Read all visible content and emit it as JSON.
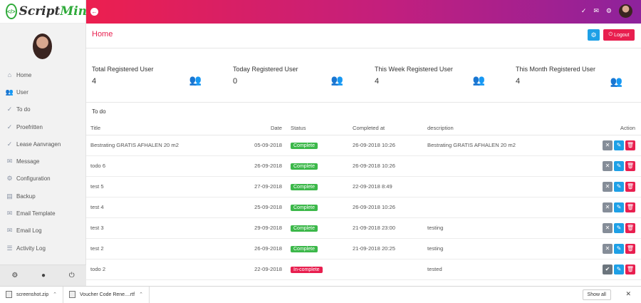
{
  "brand": {
    "part1": "Script",
    "part2": "Mint"
  },
  "header": {
    "title": "Home",
    "logout_label": "Logout"
  },
  "sidebar": {
    "items": [
      {
        "label": "Home",
        "icon": "home-icon"
      },
      {
        "label": "User",
        "icon": "users-icon"
      },
      {
        "label": "To do",
        "icon": "check-circle-icon"
      },
      {
        "label": "Proefritten",
        "icon": "check-circle-icon"
      },
      {
        "label": "Lease Aanvragen",
        "icon": "check-circle-icon"
      },
      {
        "label": "Message",
        "icon": "envelope-open-icon"
      },
      {
        "label": "Configuration",
        "icon": "gears-icon"
      },
      {
        "label": "Backup",
        "icon": "database-icon"
      },
      {
        "label": "Email Template",
        "icon": "envelope-icon"
      },
      {
        "label": "Email Log",
        "icon": "envelope-icon"
      },
      {
        "label": "Activity Log",
        "icon": "list-icon"
      }
    ]
  },
  "stats": [
    {
      "label": "Total Registered User",
      "value": "4"
    },
    {
      "label": "Today Registered User",
      "value": "0"
    },
    {
      "label": "This Week Registered User",
      "value": "4"
    },
    {
      "label": "This Month Registered User",
      "value": "4"
    }
  ],
  "todo": {
    "heading": "To do",
    "columns": {
      "title": "Title",
      "date": "Date",
      "status": "Status",
      "completed": "Completed at",
      "description": "description",
      "action": "Action"
    },
    "rows": [
      {
        "title": "Bestrating GRATIS AFHALEN 20 m2",
        "date": "05-09-2018",
        "status": "Complete",
        "completed": "26-09-2018 10:26",
        "description": "Bestrating GRATIS AFHALEN 20 m2"
      },
      {
        "title": "todo 6",
        "date": "26-09-2018",
        "status": "Complete",
        "completed": "26-09-2018 10:26",
        "description": ""
      },
      {
        "title": "test 5",
        "date": "27-09-2018",
        "status": "Complete",
        "completed": "22-09-2018 8:49",
        "description": ""
      },
      {
        "title": "test 4",
        "date": "25-09-2018",
        "status": "Complete",
        "completed": "26-09-2018 10:26",
        "description": ""
      },
      {
        "title": "test 3",
        "date": "29-09-2018",
        "status": "Complete",
        "completed": "21-09-2018 23:00",
        "description": "testing"
      },
      {
        "title": "test 2",
        "date": "26-09-2018",
        "status": "Complete",
        "completed": "21-09-2018 20:25",
        "description": "testing"
      },
      {
        "title": "todo 2",
        "date": "22-09-2018",
        "status": "In-complete",
        "completed": "",
        "description": "tested"
      }
    ]
  },
  "downloads": {
    "items": [
      {
        "name": "screenshot.zip"
      },
      {
        "name": "Voucher Code Rene....rtf"
      }
    ],
    "show_all": "Show all"
  },
  "colors": {
    "accent": "#e81f4f",
    "gradient_end": "#8d229c",
    "complete": "#3cb84a",
    "edit": "#1ea0e6"
  }
}
